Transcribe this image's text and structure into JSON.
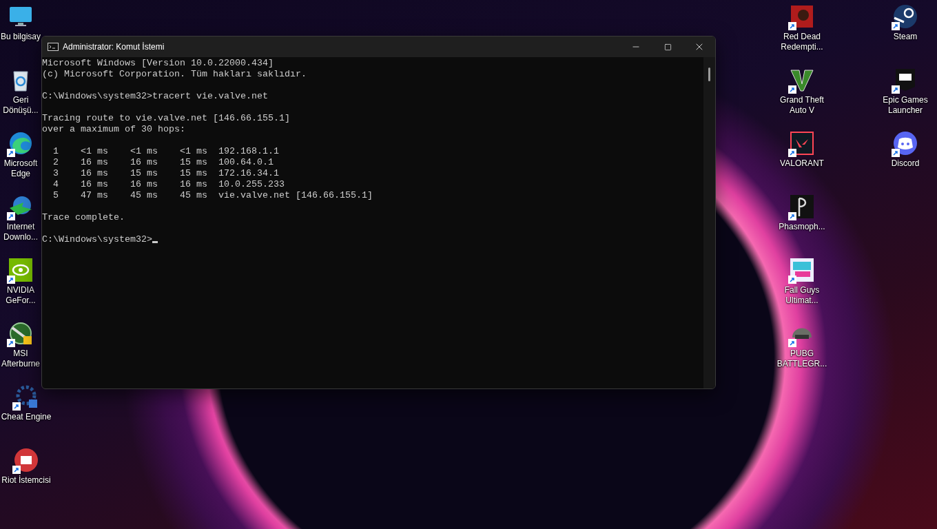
{
  "desktop_left": [
    {
      "kind": "monitor",
      "label": [
        "Bu bilgisay"
      ],
      "shortcut": false
    },
    {
      "kind": "recycle-bin",
      "label": [
        "Geri",
        "Dönüşü..."
      ],
      "shortcut": false
    },
    {
      "kind": "edge",
      "label": [
        "Microsoft",
        "Edge"
      ],
      "shortcut": true
    },
    {
      "kind": "idm",
      "label": [
        "Internet",
        "Downlo..."
      ],
      "shortcut": true
    },
    {
      "kind": "nvidia",
      "label": [
        "NVIDIA",
        "GeFor..."
      ],
      "shortcut": true
    },
    {
      "kind": "msi",
      "label": [
        "MSI",
        "Afterburne"
      ],
      "shortcut": true
    },
    {
      "kind": "cheat-engine",
      "label": [
        "Cheat Engine"
      ],
      "shortcut": true
    },
    {
      "kind": "riot",
      "label": [
        "Riot İstemcisi"
      ],
      "shortcut": true
    }
  ],
  "desktop_right_1": [
    {
      "kind": "rdr",
      "label": [
        "Red Dead",
        "Redempti..."
      ],
      "shortcut": true
    },
    {
      "kind": "gta",
      "label": [
        "Grand Theft",
        "Auto V"
      ],
      "shortcut": true
    },
    {
      "kind": "valorant",
      "label": [
        "VALORANT"
      ],
      "shortcut": true
    },
    {
      "kind": "phasmo",
      "label": [
        "Phasmoph..."
      ],
      "shortcut": true
    },
    {
      "kind": "fallguys",
      "label": [
        "Fall Guys",
        "Ultimat..."
      ],
      "shortcut": true
    },
    {
      "kind": "pubg",
      "label": [
        "PUBG",
        "BATTLEGR..."
      ],
      "shortcut": true
    }
  ],
  "desktop_right_2": [
    {
      "kind": "steam",
      "label": [
        "Steam"
      ],
      "shortcut": true
    },
    {
      "kind": "epic",
      "label": [
        "Epic Games",
        "Launcher"
      ],
      "shortcut": true
    },
    {
      "kind": "discord",
      "label": [
        "Discord"
      ],
      "shortcut": true
    }
  ],
  "window": {
    "title": "Administrator: Komut İstemi",
    "console_blocks": [
      [
        "Microsoft Windows [Version 10.0.22000.434]",
        "(c) Microsoft Corporation. Tüm hakları saklıdır."
      ],
      [
        "C:\\Windows\\system32>tracert vie.valve.net"
      ],
      [
        "Tracing route to vie.valve.net [146.66.155.1]",
        "over a maximum of 30 hops:"
      ],
      [
        "  1    <1 ms    <1 ms    <1 ms  192.168.1.1",
        "  2    16 ms    16 ms    15 ms  100.64.0.1",
        "  3    16 ms    15 ms    15 ms  172.16.34.1",
        "  4    16 ms    16 ms    16 ms  10.0.255.233",
        "  5    47 ms    45 ms    45 ms  vie.valve.net [146.66.155.1]"
      ],
      [
        "Trace complete."
      ]
    ],
    "prompt": "C:\\Windows\\system32>"
  }
}
